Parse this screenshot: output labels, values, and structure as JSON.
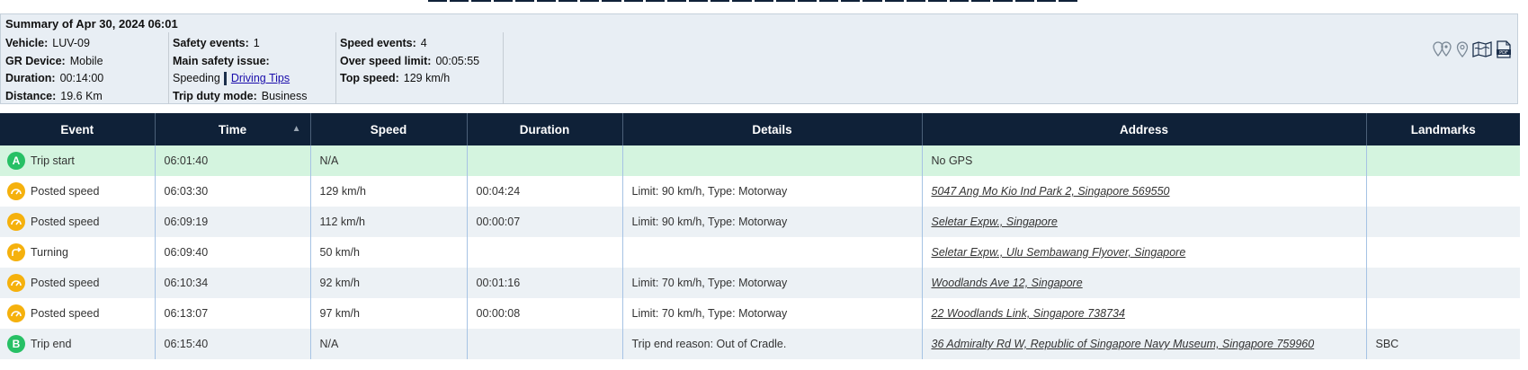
{
  "summary": {
    "title": "Summary of Apr 30, 2024 06:01",
    "col1": [
      {
        "label": "Vehicle:",
        "value": "LUV-09"
      },
      {
        "label": "GR Device:",
        "value": "Mobile"
      },
      {
        "label": "Duration:",
        "value": "00:14:00"
      },
      {
        "label": "Distance:",
        "value": "19.6 Km"
      }
    ],
    "col2": {
      "safety_label": "Safety events:",
      "safety_value": "1",
      "issue_label": "Main safety issue:",
      "issue_value": "Speeding",
      "tips_link": "Driving Tips",
      "duty_label": "Trip duty mode:",
      "duty_value": "Business"
    },
    "col3": [
      {
        "label": "Speed events:",
        "value": "4"
      },
      {
        "label": "Over speed limit:",
        "value": "00:05:55"
      },
      {
        "label": "Top speed:",
        "value": "129 km/h"
      }
    ],
    "tools": [
      "route-pins-icon",
      "location-pin-icon",
      "map-icon",
      "pdf-icon"
    ]
  },
  "table": {
    "headers": [
      "Event",
      "Time",
      "Speed",
      "Duration",
      "Details",
      "Address",
      "Landmarks"
    ],
    "rows": [
      {
        "badge": "A",
        "icon": "trip-start-icon",
        "event": "Trip start",
        "time": "06:01:40",
        "speed": "N/A",
        "duration": "",
        "details": "",
        "address": "No GPS",
        "landmarks": ""
      },
      {
        "badge": "",
        "icon": "speedometer-icon",
        "event": "Posted speed",
        "time": "06:03:30",
        "speed": "129 km/h",
        "duration": "00:04:24",
        "details": "Limit: 90 km/h, Type: Motorway",
        "address": "5047 Ang Mo Kio Ind Park 2, Singapore 569550",
        "landmarks": ""
      },
      {
        "badge": "",
        "icon": "speedometer-icon",
        "event": "Posted speed",
        "time": "06:09:19",
        "speed": "112 km/h",
        "duration": "00:00:07",
        "details": "Limit: 90 km/h, Type: Motorway",
        "address": "Seletar Expw., Singapore",
        "landmarks": ""
      },
      {
        "badge": "",
        "icon": "turning-icon",
        "event": "Turning",
        "time": "06:09:40",
        "speed": "50 km/h",
        "duration": "",
        "details": "",
        "address": "Seletar Expw., Ulu Sembawang Flyover, Singapore",
        "landmarks": ""
      },
      {
        "badge": "",
        "icon": "speedometer-icon",
        "event": "Posted speed",
        "time": "06:10:34",
        "speed": "92 km/h",
        "duration": "00:01:16",
        "details": "Limit: 70 km/h, Type: Motorway",
        "address": "Woodlands Ave 12, Singapore",
        "landmarks": ""
      },
      {
        "badge": "",
        "icon": "speedometer-icon",
        "event": "Posted speed",
        "time": "06:13:07",
        "speed": "97 km/h",
        "duration": "00:00:08",
        "details": "Limit: 70 km/h, Type: Motorway",
        "address": "22 Woodlands Link, Singapore 738734",
        "landmarks": ""
      },
      {
        "badge": "B",
        "icon": "trip-end-icon",
        "event": "Trip end",
        "time": "06:15:40",
        "speed": "N/A",
        "duration": "",
        "details": "Trip end reason: Out of Cradle.",
        "address": "36 Admiralty Rd W, Republic of Singapore Navy Museum, Singapore 759960",
        "landmarks": "SBC"
      }
    ]
  },
  "colors": {
    "header_bg": "#0f2138",
    "badge_green": "#27c065",
    "badge_orange": "#f5b10d",
    "start_row_bg": "#d4f4df"
  }
}
